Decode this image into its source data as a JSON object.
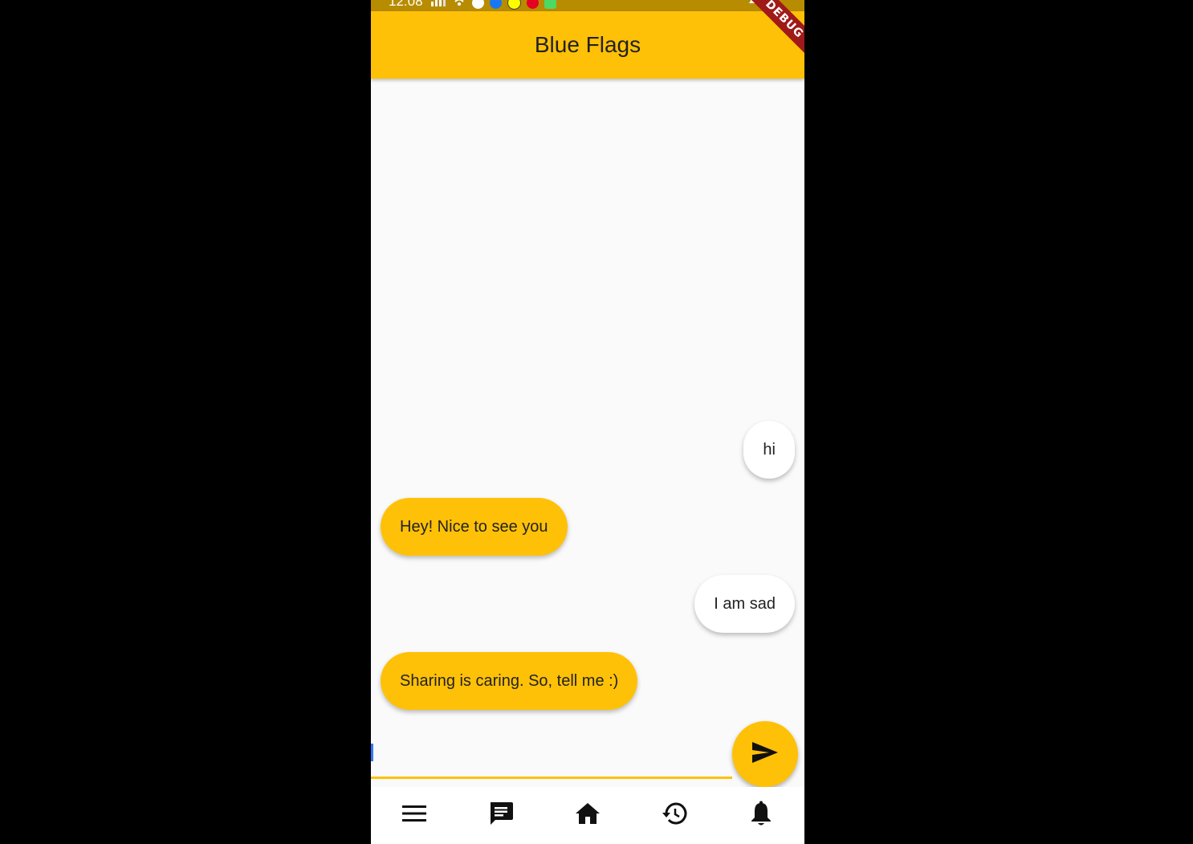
{
  "status_bar": {
    "time": "12:08",
    "icons": [
      "signal-icon",
      "wifi-icon",
      "app-notification-icon",
      "facebook-icon",
      "snapchat-icon",
      "pinterest-icon",
      "message-icon"
    ],
    "right_icons": [
      "mute-icon"
    ]
  },
  "app_bar": {
    "title": "Blue Flags",
    "debug_banner": "DEBUG"
  },
  "messages": [
    {
      "sender": "user",
      "text": "hi"
    },
    {
      "sender": "bot",
      "text": "Hey! Nice to see you"
    },
    {
      "sender": "user",
      "text": "I am sad"
    },
    {
      "sender": "bot",
      "text": "Sharing is caring. So, tell me :)"
    }
  ],
  "input": {
    "value": "",
    "placeholder": ""
  },
  "send_button": {
    "icon": "send-icon"
  },
  "bottom_nav": {
    "items": [
      {
        "icon": "menu-icon"
      },
      {
        "icon": "chat-icon"
      },
      {
        "icon": "home-icon"
      },
      {
        "icon": "history-icon"
      },
      {
        "icon": "notifications-icon"
      }
    ]
  },
  "colors": {
    "accent": "#ffc107",
    "status_bar": "#b88c00",
    "background": "#fafafa",
    "user_bubble": "#ffffff",
    "bot_bubble": "#ffc107",
    "debug_banner": "#a01a1a"
  }
}
